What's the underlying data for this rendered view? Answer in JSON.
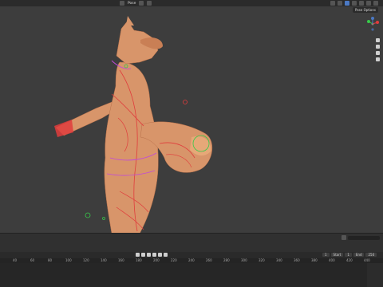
{
  "header": {
    "mode_label": "Pose",
    "pose_options_label": "Pose Options"
  },
  "timeline": {
    "start_frame": "1",
    "start_label": "Start",
    "start_value": "1",
    "end_label": "End",
    "end_value": "250",
    "ticks": [
      "40",
      "60",
      "80",
      "100",
      "120",
      "140",
      "160",
      "180",
      "200",
      "220",
      "240",
      "260",
      "280",
      "300",
      "320",
      "340",
      "360",
      "380",
      "400",
      "420",
      "440",
      "460"
    ]
  },
  "colors": {
    "viewport_bg": "#3d3d3d",
    "skin": "#d8956a",
    "bone_red": "#e03c3c",
    "bone_magenta": "#c04ad8",
    "bone_green": "#38c94a",
    "accent_blue": "#4b79c4"
  },
  "icons": {
    "gizmo": "axis-gizmo-icon",
    "zoom": "zoom-icon",
    "pan": "hand-icon",
    "camera": "camera-icon",
    "grid": "grid-icon"
  }
}
